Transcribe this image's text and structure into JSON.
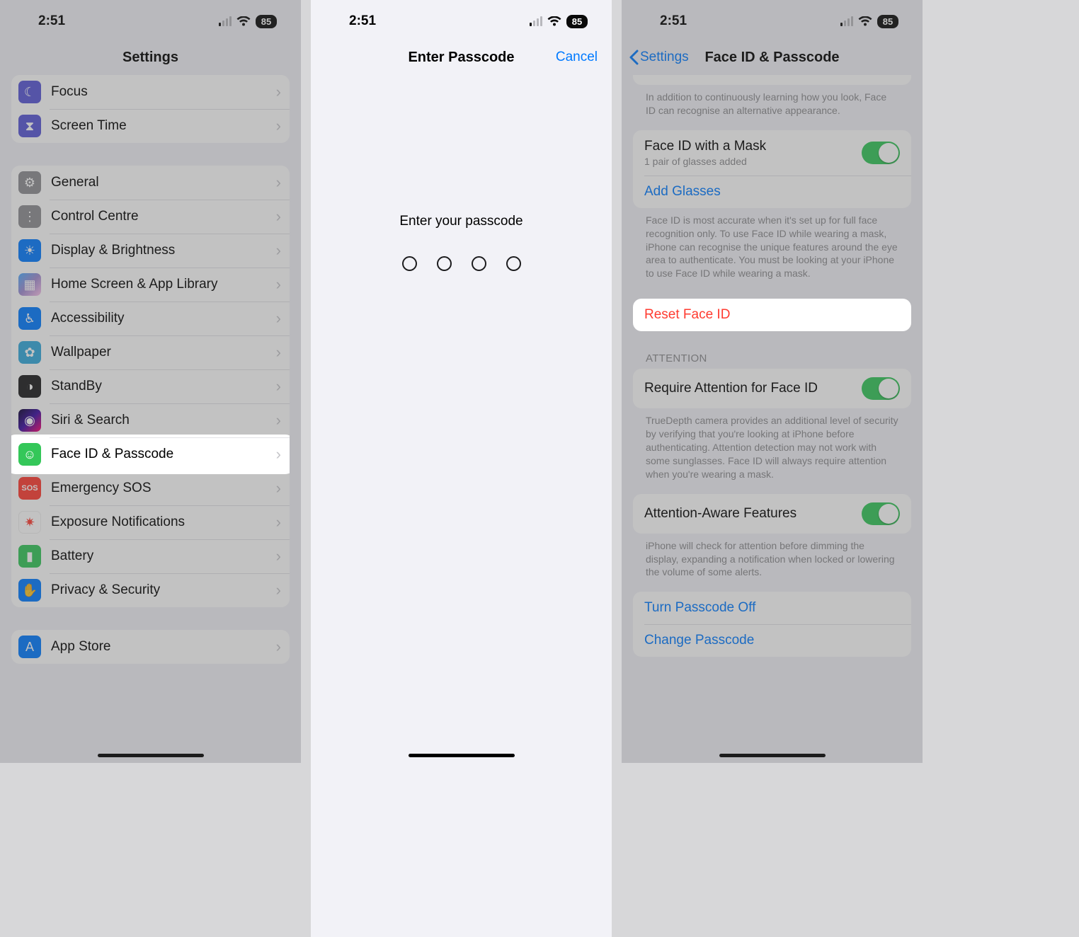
{
  "status": {
    "time": "2:51",
    "battery": "85"
  },
  "p1": {
    "title": "Settings",
    "group1": [
      {
        "label": "Focus"
      },
      {
        "label": "Screen Time"
      }
    ],
    "group2": [
      {
        "label": "General"
      },
      {
        "label": "Control Centre"
      },
      {
        "label": "Display & Brightness"
      },
      {
        "label": "Home Screen & App Library"
      },
      {
        "label": "Accessibility"
      },
      {
        "label": "Wallpaper"
      },
      {
        "label": "StandBy"
      },
      {
        "label": "Siri & Search"
      },
      {
        "label": "Face ID & Passcode"
      },
      {
        "label": "Emergency SOS"
      },
      {
        "label": "Exposure Notifications"
      },
      {
        "label": "Battery"
      },
      {
        "label": "Privacy & Security"
      }
    ],
    "group3": [
      {
        "label": "App Store"
      }
    ]
  },
  "p2": {
    "title": "Enter Passcode",
    "cancel": "Cancel",
    "prompt": "Enter your passcode"
  },
  "p3": {
    "back": "Settings",
    "title": "Face ID & Passcode",
    "alt_appearance_note": "In addition to continuously learning how you look, Face ID can recognise an alternative appearance.",
    "mask_label": "Face ID with a Mask",
    "mask_sub": "1 pair of glasses added",
    "add_glasses": "Add Glasses",
    "mask_note": "Face ID is most accurate when it's set up for full face recognition only. To use Face ID while wearing a mask, iPhone can recognise the unique features around the eye area to authenticate. You must be looking at your iPhone to use Face ID while wearing a mask.",
    "reset": "Reset Face ID",
    "attention_header": "ATTENTION",
    "require_attention": "Require Attention for Face ID",
    "require_note": "TrueDepth camera provides an additional level of security by verifying that you're looking at iPhone before authenticating. Attention detection may not work with some sunglasses. Face ID will always require attention when you're wearing a mask.",
    "aware": "Attention-Aware Features",
    "aware_note": "iPhone will check for attention before dimming the display, expanding a notification when locked or lowering the volume of some alerts.",
    "turn_off": "Turn Passcode Off",
    "change": "Change Passcode"
  }
}
